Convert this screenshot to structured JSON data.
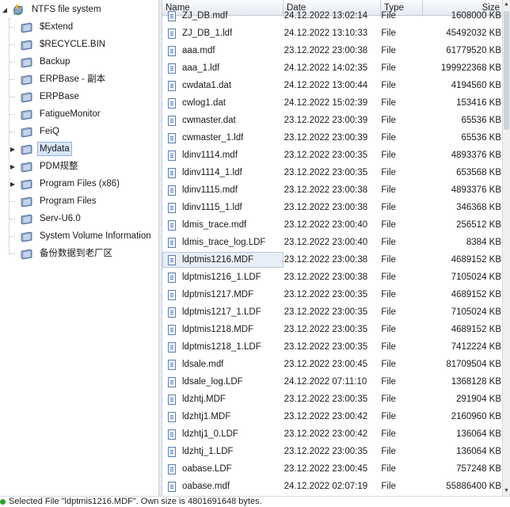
{
  "tree": {
    "root_label": "NTFS file system",
    "items": [
      {
        "label": "$Extend",
        "expandable": false
      },
      {
        "label": "$RECYCLE.BIN",
        "expandable": false
      },
      {
        "label": "Backup",
        "expandable": false
      },
      {
        "label": "ERPBase - 副本",
        "expandable": false
      },
      {
        "label": "ERPBase",
        "expandable": false
      },
      {
        "label": "FatigueMonitor",
        "expandable": false
      },
      {
        "label": "FeiQ",
        "expandable": false
      },
      {
        "label": "Mydata",
        "expandable": true,
        "selected": true
      },
      {
        "label": "PDM规整",
        "expandable": true
      },
      {
        "label": "Program Files (x86)",
        "expandable": true
      },
      {
        "label": "Program Files",
        "expandable": false
      },
      {
        "label": "Serv-U6.0",
        "expandable": false
      },
      {
        "label": "System Volume Information",
        "expandable": false
      },
      {
        "label": "备份数据到老厂区",
        "expandable": false
      }
    ]
  },
  "columns": {
    "name": "Name",
    "date": "Date",
    "type": "Type",
    "size": "Size"
  },
  "files": [
    {
      "name": "ZJ_DB.mdf",
      "date": "24.12.2022 13:02:14",
      "type": "File",
      "size": "1608000 KB"
    },
    {
      "name": "ZJ_DB_1.ldf",
      "date": "24.12.2022 13:10:33",
      "type": "File",
      "size": "45492032 KB"
    },
    {
      "name": "aaa.mdf",
      "date": "23.12.2022 23:00:38",
      "type": "File",
      "size": "61779520 KB"
    },
    {
      "name": "aaa_1.ldf",
      "date": "24.12.2022 14:02:35",
      "type": "File",
      "size": "199922368 KB"
    },
    {
      "name": "cwdata1.dat",
      "date": "24.12.2022 13:00:44",
      "type": "File",
      "size": "4194560 KB"
    },
    {
      "name": "cwlog1.dat",
      "date": "24.12.2022 15:02:39",
      "type": "File",
      "size": "153416 KB"
    },
    {
      "name": "cwmaster.dat",
      "date": "23.12.2022 23:00:39",
      "type": "File",
      "size": "65536 KB"
    },
    {
      "name": "cwmaster_1.ldf",
      "date": "23.12.2022 23:00:39",
      "type": "File",
      "size": "65536 KB"
    },
    {
      "name": "ldinv1114.mdf",
      "date": "23.12.2022 23:00:35",
      "type": "File",
      "size": "4893376 KB"
    },
    {
      "name": "ldinv1114_1.ldf",
      "date": "23.12.2022 23:00:35",
      "type": "File",
      "size": "653568 KB"
    },
    {
      "name": "ldinv1115.mdf",
      "date": "23.12.2022 23:00:38",
      "type": "File",
      "size": "4893376 KB"
    },
    {
      "name": "ldinv1115_1.ldf",
      "date": "23.12.2022 23:00:38",
      "type": "File",
      "size": "346368 KB"
    },
    {
      "name": "ldmis_trace.mdf",
      "date": "23.12.2022 23:00:40",
      "type": "File",
      "size": "256512 KB"
    },
    {
      "name": "ldmis_trace_log.LDF",
      "date": "23.12.2022 23:00:40",
      "type": "File",
      "size": "8384 KB"
    },
    {
      "name": "ldptmis1216.MDF",
      "date": "23.12.2022 23:00:38",
      "type": "File",
      "size": "4689152 KB",
      "selected": true
    },
    {
      "name": "ldptmis1216_1.LDF",
      "date": "23.12.2022 23:00:38",
      "type": "File",
      "size": "7105024 KB"
    },
    {
      "name": "ldptmis1217.MDF",
      "date": "23.12.2022 23:00:35",
      "type": "File",
      "size": "4689152 KB"
    },
    {
      "name": "ldptmis1217_1.LDF",
      "date": "23.12.2022 23:00:35",
      "type": "File",
      "size": "7105024 KB"
    },
    {
      "name": "ldptmis1218.MDF",
      "date": "23.12.2022 23:00:35",
      "type": "File",
      "size": "4689152 KB"
    },
    {
      "name": "ldptmis1218_1.LDF",
      "date": "23.12.2022 23:00:35",
      "type": "File",
      "size": "7412224 KB"
    },
    {
      "name": "ldsale.mdf",
      "date": "23.12.2022 23:00:45",
      "type": "File",
      "size": "81709504 KB"
    },
    {
      "name": "ldsale_log.LDF",
      "date": "24.12.2022 07:11:10",
      "type": "File",
      "size": "1368128 KB"
    },
    {
      "name": "ldzhtj.MDF",
      "date": "23.12.2022 23:00:35",
      "type": "File",
      "size": "291904 KB"
    },
    {
      "name": "ldzhtj1.MDF",
      "date": "23.12.2022 23:00:42",
      "type": "File",
      "size": "2160960 KB"
    },
    {
      "name": "ldzhtj1_0.LDF",
      "date": "23.12.2022 23:00:42",
      "type": "File",
      "size": "136064 KB"
    },
    {
      "name": "ldzhtj_1.LDF",
      "date": "23.12.2022 23:00:35",
      "type": "File",
      "size": "136064 KB"
    },
    {
      "name": "oabase.LDF",
      "date": "23.12.2022 23:00:45",
      "type": "File",
      "size": "757248 KB"
    },
    {
      "name": "oabase.mdf",
      "date": "24.12.2022 02:07:19",
      "type": "File",
      "size": "55886400 KB"
    }
  ],
  "status": {
    "text": "Selected File \"ldptmis1216.MDF\". Own size is 4801691648 bytes.",
    "color": "#2ea12e"
  },
  "colors": {
    "selection": "#d9e7fb",
    "folder": "#8aa6cc"
  }
}
